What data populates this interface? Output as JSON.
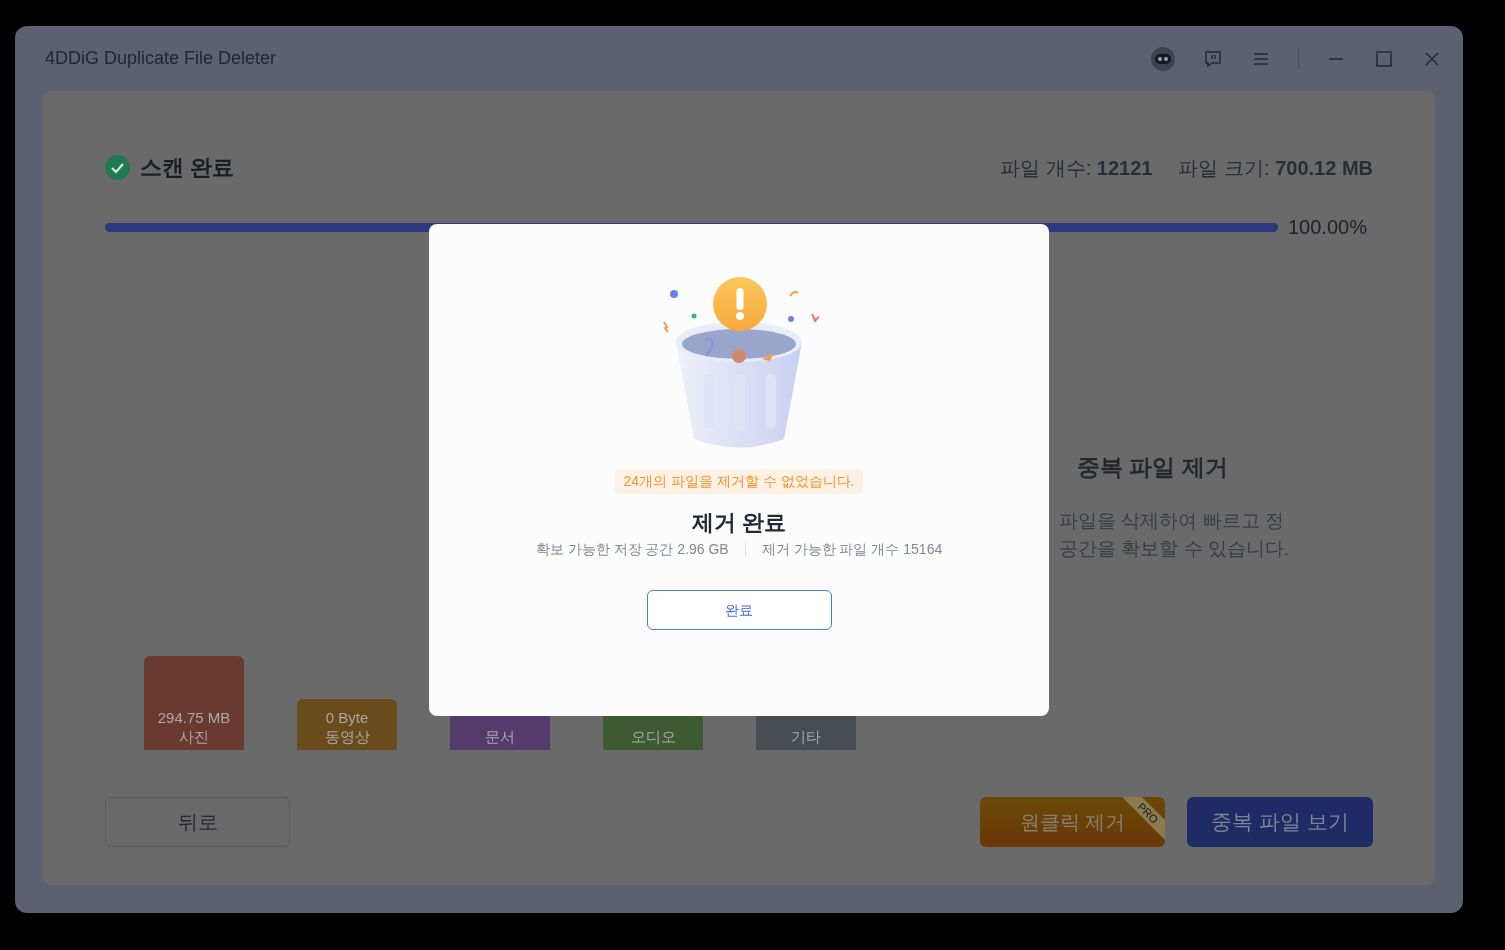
{
  "window": {
    "title": "4DDiG Duplicate File Deleter"
  },
  "scan": {
    "status": "스캔 완료",
    "file_count_label": "파일 개수:",
    "file_count": "12121",
    "file_size_label": "파일 크기:",
    "file_size": "700.12 MB",
    "level": 1,
    "percent": "100.00%"
  },
  "categories": [
    {
      "size": "294.75 MB",
      "name": "사진",
      "color": "#6a3a30"
    },
    {
      "size": "0 Byte",
      "name": "동영상",
      "color": "#6a4b1c"
    },
    {
      "name": "문서",
      "color": "#553a6c"
    },
    {
      "name": "오디오",
      "color": "#3e5a32"
    },
    {
      "name": "기타",
      "color": "#474b52"
    }
  ],
  "promo": {
    "heading": "중복 파일 제거",
    "lines": [
      "파일을 삭제하여 빠르고 정",
      "공간을 확보할 수 있습니다."
    ]
  },
  "buttons": {
    "back": "뒤로",
    "one_click": "원클릭 제거",
    "pro_badge": "PRO",
    "view": "중복 파일 보기"
  },
  "dialog": {
    "warning": "24개의 파일을 제거할 수 없었습니다.",
    "title": "제거 완료",
    "stats": [
      "확보 가능한 저장 공간 2.96 GB",
      "제거 가능한 파일 개수 15164"
    ],
    "button": "완료"
  }
}
